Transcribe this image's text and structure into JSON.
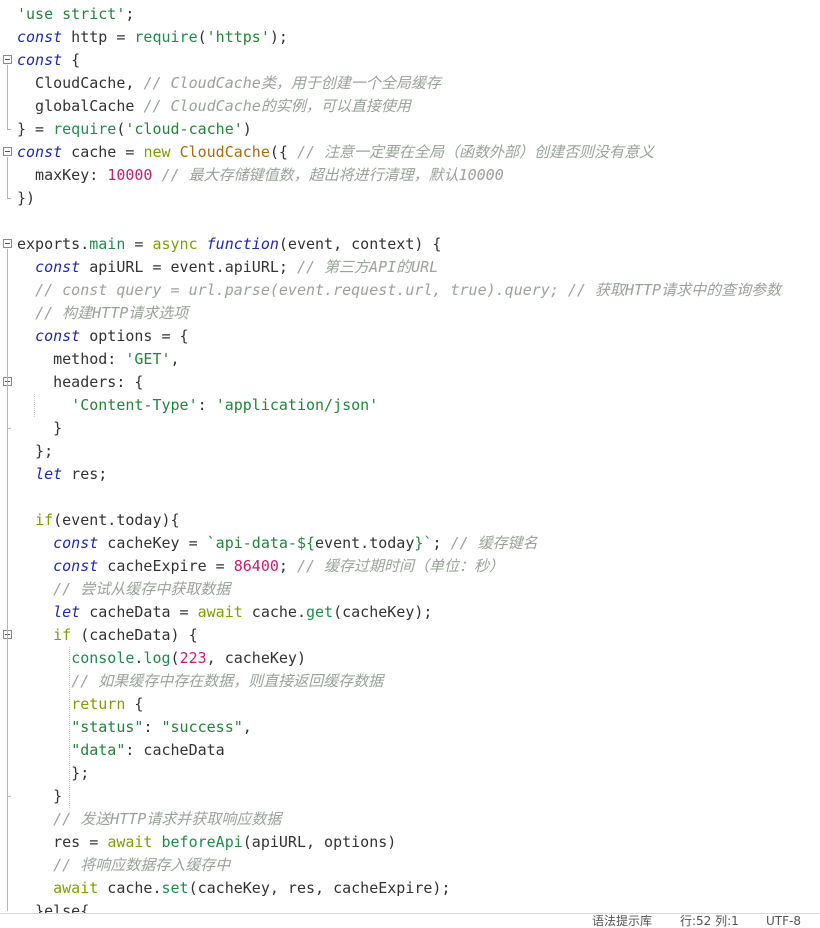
{
  "editor": {
    "lines": [
      {
        "fold": false,
        "tokens": [
          [
            "str",
            "'use strict'"
          ],
          [
            "plain",
            ";"
          ]
        ]
      },
      {
        "fold": false,
        "tokens": [
          [
            "kw",
            "const"
          ],
          [
            "plain",
            " http = "
          ],
          [
            "fn",
            "require"
          ],
          [
            "plain",
            "("
          ],
          [
            "str",
            "'https'"
          ],
          [
            "plain",
            ");"
          ]
        ]
      },
      {
        "fold": true,
        "tokens": [
          [
            "kw",
            "const"
          ],
          [
            "plain",
            " {"
          ]
        ]
      },
      {
        "fold": false,
        "tokens": [
          [
            "plain",
            "  CloudCache, "
          ],
          [
            "com",
            "// CloudCache类，用于创建一个全局缓存"
          ]
        ]
      },
      {
        "fold": false,
        "tokens": [
          [
            "plain",
            "  globalCache "
          ],
          [
            "com",
            "// CloudCache的实例，可以直接使用"
          ]
        ]
      },
      {
        "fold": false,
        "tokens": [
          [
            "plain",
            "} = "
          ],
          [
            "fn",
            "require"
          ],
          [
            "plain",
            "("
          ],
          [
            "str",
            "'cloud-cache'"
          ],
          [
            "plain",
            ")"
          ]
        ]
      },
      {
        "fold": true,
        "tokens": [
          [
            "kw",
            "const"
          ],
          [
            "plain",
            " cache = "
          ],
          [
            "kw2",
            "new"
          ],
          [
            "plain",
            " "
          ],
          [
            "cls",
            "CloudCache"
          ],
          [
            "plain",
            "({ "
          ],
          [
            "com",
            "// 注意一定要在全局（函数外部）创建否则没有意义"
          ]
        ]
      },
      {
        "fold": false,
        "tokens": [
          [
            "plain",
            "  maxKey: "
          ],
          [
            "num",
            "10000"
          ],
          [
            "plain",
            " "
          ],
          [
            "com",
            "// 最大存储键值数，超出将进行清理，默认10000"
          ]
        ]
      },
      {
        "fold": false,
        "tokens": [
          [
            "plain",
            "})"
          ]
        ]
      },
      {
        "fold": false,
        "tokens": []
      },
      {
        "fold": true,
        "tokens": [
          [
            "plain",
            "exports."
          ],
          [
            "fn",
            "main"
          ],
          [
            "plain",
            " = "
          ],
          [
            "kw2",
            "async"
          ],
          [
            "plain",
            " "
          ],
          [
            "kw",
            "function"
          ],
          [
            "plain",
            "(event, context) {"
          ]
        ]
      },
      {
        "fold": false,
        "tokens": [
          [
            "plain",
            "  "
          ],
          [
            "kw",
            "const"
          ],
          [
            "plain",
            " apiURL = event.apiURL; "
          ],
          [
            "com",
            "// 第三方API的URL"
          ]
        ]
      },
      {
        "fold": false,
        "tokens": [
          [
            "plain",
            "  "
          ],
          [
            "com",
            "// const query = url.parse(event.request.url, true).query; // 获取HTTP请求中的查询参数"
          ]
        ]
      },
      {
        "fold": false,
        "tokens": [
          [
            "plain",
            "  "
          ],
          [
            "com",
            "// 构建HTTP请求选项"
          ]
        ]
      },
      {
        "fold": false,
        "tokens": [
          [
            "plain",
            "  "
          ],
          [
            "kw",
            "const"
          ],
          [
            "plain",
            " options = {"
          ]
        ]
      },
      {
        "fold": false,
        "tokens": [
          [
            "plain",
            "    method: "
          ],
          [
            "str",
            "'GET'"
          ],
          [
            "plain",
            ","
          ]
        ]
      },
      {
        "fold": true,
        "tokens": [
          [
            "plain",
            "    headers: {"
          ]
        ]
      },
      {
        "fold": false,
        "tokens": [
          [
            "plain",
            "      "
          ],
          [
            "str",
            "'Content-Type'"
          ],
          [
            "plain",
            ": "
          ],
          [
            "str",
            "'application/json'"
          ]
        ]
      },
      {
        "fold": false,
        "tokens": [
          [
            "plain",
            "    }"
          ]
        ]
      },
      {
        "fold": false,
        "tokens": [
          [
            "plain",
            "  };"
          ]
        ]
      },
      {
        "fold": false,
        "tokens": [
          [
            "plain",
            "  "
          ],
          [
            "kw",
            "let"
          ],
          [
            "plain",
            " res;"
          ]
        ]
      },
      {
        "fold": false,
        "tokens": []
      },
      {
        "fold": false,
        "tokens": [
          [
            "plain",
            "  "
          ],
          [
            "kw2",
            "if"
          ],
          [
            "plain",
            "(event.today){"
          ]
        ]
      },
      {
        "fold": false,
        "tokens": [
          [
            "plain",
            "    "
          ],
          [
            "kw",
            "const"
          ],
          [
            "plain",
            " cacheKey = "
          ],
          [
            "str",
            "`api-data-${"
          ],
          [
            "plain",
            "event.today"
          ],
          [
            "str",
            "}`"
          ],
          [
            "plain",
            "; "
          ],
          [
            "com",
            "// 缓存键名"
          ]
        ]
      },
      {
        "fold": false,
        "tokens": [
          [
            "plain",
            "    "
          ],
          [
            "kw",
            "const"
          ],
          [
            "plain",
            " cacheExpire = "
          ],
          [
            "num",
            "86400"
          ],
          [
            "plain",
            "; "
          ],
          [
            "com",
            "// 缓存过期时间（单位：秒）"
          ]
        ]
      },
      {
        "fold": false,
        "tokens": [
          [
            "plain",
            "    "
          ],
          [
            "com",
            "// 尝试从缓存中获取数据"
          ]
        ]
      },
      {
        "fold": false,
        "tokens": [
          [
            "plain",
            "    "
          ],
          [
            "kw",
            "let"
          ],
          [
            "plain",
            " cacheData = "
          ],
          [
            "kw2",
            "await"
          ],
          [
            "plain",
            " cache."
          ],
          [
            "fn",
            "get"
          ],
          [
            "plain",
            "(cacheKey);"
          ]
        ]
      },
      {
        "fold": true,
        "tokens": [
          [
            "plain",
            "    "
          ],
          [
            "kw2",
            "if"
          ],
          [
            "plain",
            " (cacheData) {"
          ]
        ]
      },
      {
        "fold": false,
        "tokens": [
          [
            "plain",
            "      "
          ],
          [
            "fn",
            "console"
          ],
          [
            "plain",
            "."
          ],
          [
            "fn",
            "log"
          ],
          [
            "plain",
            "("
          ],
          [
            "num",
            "223"
          ],
          [
            "plain",
            ", cacheKey)"
          ]
        ]
      },
      {
        "fold": false,
        "tokens": [
          [
            "plain",
            "      "
          ],
          [
            "com",
            "// 如果缓存中存在数据，则直接返回缓存数据"
          ]
        ]
      },
      {
        "fold": false,
        "tokens": [
          [
            "plain",
            "      "
          ],
          [
            "kw2",
            "return"
          ],
          [
            "plain",
            " {"
          ]
        ]
      },
      {
        "fold": false,
        "tokens": [
          [
            "plain",
            "      "
          ],
          [
            "str",
            "\"status\""
          ],
          [
            "plain",
            ": "
          ],
          [
            "str",
            "\"success\""
          ],
          [
            "plain",
            ","
          ]
        ]
      },
      {
        "fold": false,
        "tokens": [
          [
            "plain",
            "      "
          ],
          [
            "str",
            "\"data\""
          ],
          [
            "plain",
            ": cacheData"
          ]
        ]
      },
      {
        "fold": false,
        "tokens": [
          [
            "plain",
            "      };"
          ]
        ]
      },
      {
        "fold": false,
        "tokens": [
          [
            "plain",
            "    }"
          ]
        ]
      },
      {
        "fold": false,
        "tokens": [
          [
            "plain",
            "    "
          ],
          [
            "com",
            "// 发送HTTP请求并获取响应数据"
          ]
        ]
      },
      {
        "fold": false,
        "tokens": [
          [
            "plain",
            "    res = "
          ],
          [
            "kw2",
            "await"
          ],
          [
            "plain",
            " "
          ],
          [
            "fn",
            "beforeApi"
          ],
          [
            "plain",
            "(apiURL, options)"
          ]
        ]
      },
      {
        "fold": false,
        "tokens": [
          [
            "plain",
            "    "
          ],
          [
            "com",
            "// 将响应数据存入缓存中"
          ]
        ]
      },
      {
        "fold": false,
        "tokens": [
          [
            "plain",
            "    "
          ],
          [
            "kw2",
            "await"
          ],
          [
            "plain",
            " cache."
          ],
          [
            "fn",
            "set"
          ],
          [
            "plain",
            "(cacheKey, res, cacheExpire);"
          ]
        ]
      },
      {
        "fold": false,
        "tokens": [
          [
            "plain",
            "  }else{"
          ]
        ]
      }
    ]
  },
  "statusbar": {
    "syntax_hint": "语法提示库",
    "position": "行:52   列:1",
    "encoding": "UTF-8"
  }
}
